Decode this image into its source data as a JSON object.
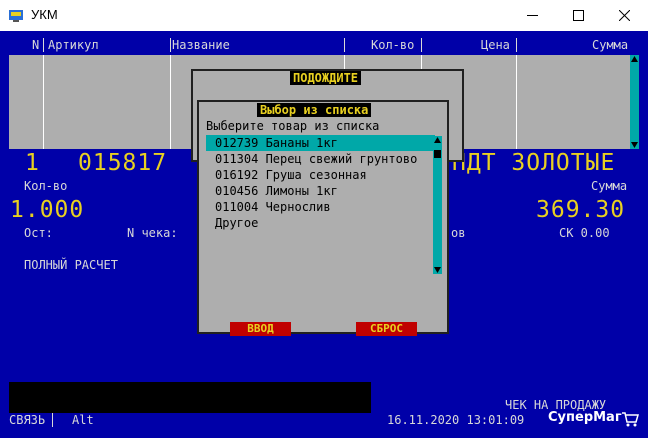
{
  "window": {
    "title": "УКМ"
  },
  "header": {
    "n": "N",
    "article": "Артикул",
    "name": "Название",
    "qty": "Кол-во",
    "price": "Цена",
    "sum": "Сумма"
  },
  "current": {
    "index": "1",
    "article": "015817",
    "name_tail": "НДТ ЗОЛОТЫЕ",
    "qty_label": "Кол-во",
    "qty_value": "1.000",
    "sum_label": "Сумма",
    "sum_value": "369.30",
    "ost_label": "Ост:",
    "check_label": "N чека:",
    "hidden_tail": "ов",
    "sk_label": "СК 0.00",
    "payment": "ПОЛНЫЙ РАСЧЕТ"
  },
  "wait_dialog": {
    "title": "ПОДОЖДИТЕ"
  },
  "select_dialog": {
    "title": "Выбор из списка",
    "prompt": "Выберите товар из списка",
    "items": [
      "012739 Бананы 1кг",
      "011304 Перец свежий грунтово",
      "016192 Груша сезонная",
      "010456 Лимоны 1кг",
      "011004 Чернослив",
      "Другое"
    ],
    "selected_index": 0,
    "ok_label": "ВВОД",
    "reset_label": "СБРОС"
  },
  "status": {
    "mode": "ЧЕК НА ПРОДАЖУ",
    "conn": "СВЯЗЬ",
    "alt": "Alt",
    "datetime": "16.11.2020 13:01:09",
    "brand": "СуперМаг"
  },
  "colors": {
    "screen_bg": "#0000a8",
    "accent_yellow": "#e8d020",
    "selection": "#00a8a8",
    "button_red": "#c00000"
  }
}
